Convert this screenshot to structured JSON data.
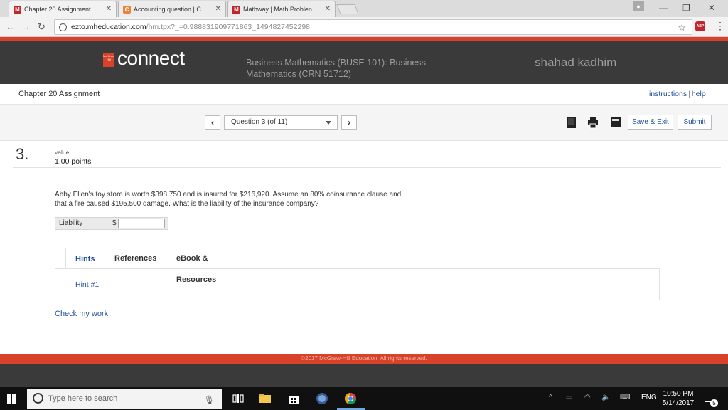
{
  "browser": {
    "tabs": [
      {
        "label": "Chapter 20 Assignment",
        "icon": "mcgraw-hill-m-icon",
        "color": "#c0262b"
      },
      {
        "label": "Accounting question | C",
        "icon": "chegg-c-icon",
        "color": "#e8833a"
      },
      {
        "label": "Mathway | Math Problen",
        "icon": "mathway-m-icon",
        "color": "#c0262b"
      }
    ],
    "url_host": "ezto.mheducation.com",
    "url_path": "/hm.tpx?_=0.988831909771863_1494827452298",
    "abp_label": "ABP"
  },
  "header": {
    "logo": "connect",
    "logo_mark": "Mc Graw Hill",
    "course": "Business Mathematics (BUSE 101): Business Mathematics (CRN 51712)",
    "user": "shahad kadhim"
  },
  "assignment": {
    "title": "Chapter 20 Assignment",
    "instructions": "instructions",
    "help": "help",
    "question_selector": "Question 3 (of 11)",
    "save_exit": "Save & Exit",
    "submit": "Submit"
  },
  "question": {
    "number": "3.",
    "value_label": "value:",
    "points": "1.00 points",
    "text": "Abby Ellen's toy store is worth $398,750 and is insured for $216,920. Assume an 80% coinsurance clause and that a fire caused $195,500 damage. What is the liability of the insurance company?",
    "answer_label": "Liability",
    "currency": "$",
    "answer_value": ""
  },
  "resources": {
    "tabs": [
      "Hints",
      "References",
      "eBook & Resources"
    ],
    "hint_link": "Hint #1",
    "check": "Check my work"
  },
  "footer": {
    "copyright": "©2017 McGraw-Hill Education. All rights reserved."
  },
  "taskbar": {
    "search_placeholder": "Type here to search",
    "language": "ENG",
    "time": "10:50 PM",
    "date": "5/14/2017",
    "notifications": "5"
  }
}
